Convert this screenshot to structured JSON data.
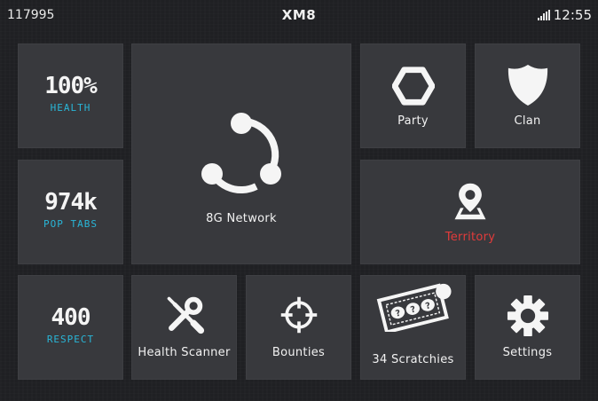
{
  "status_bar": {
    "left_text": "117995",
    "title": "XM8",
    "time": "12:55",
    "signal_icon": "signal-bars-icon"
  },
  "stats": {
    "health": {
      "value": "100%",
      "label": "HEALTH"
    },
    "pop_tabs": {
      "value": "974k",
      "label": "POP TABS"
    },
    "respect": {
      "value": "400",
      "label": "RESPECT"
    }
  },
  "apps": {
    "network": {
      "label": "8G Network",
      "icon": "share-network-icon"
    },
    "party": {
      "label": "Party",
      "icon": "hexagon-icon"
    },
    "clan": {
      "label": "Clan",
      "icon": "shield-icon"
    },
    "territory": {
      "label": "Territory",
      "icon": "map-pin-icon",
      "label_color": "#e23b3b"
    },
    "health_scanner": {
      "label": "Health Scanner",
      "icon": "wrench-screwdriver-icon"
    },
    "bounties": {
      "label": "Bounties",
      "icon": "crosshair-icon"
    },
    "scratchies": {
      "label": "34 Scratchies",
      "icon": "scratch-ticket-icon"
    },
    "settings": {
      "label": "Settings",
      "icon": "gear-icon"
    }
  },
  "colors": {
    "background": "#1f2023",
    "tile": "#38393d",
    "accent_cyan": "#29b6d8",
    "accent_red": "#e23b3b"
  }
}
